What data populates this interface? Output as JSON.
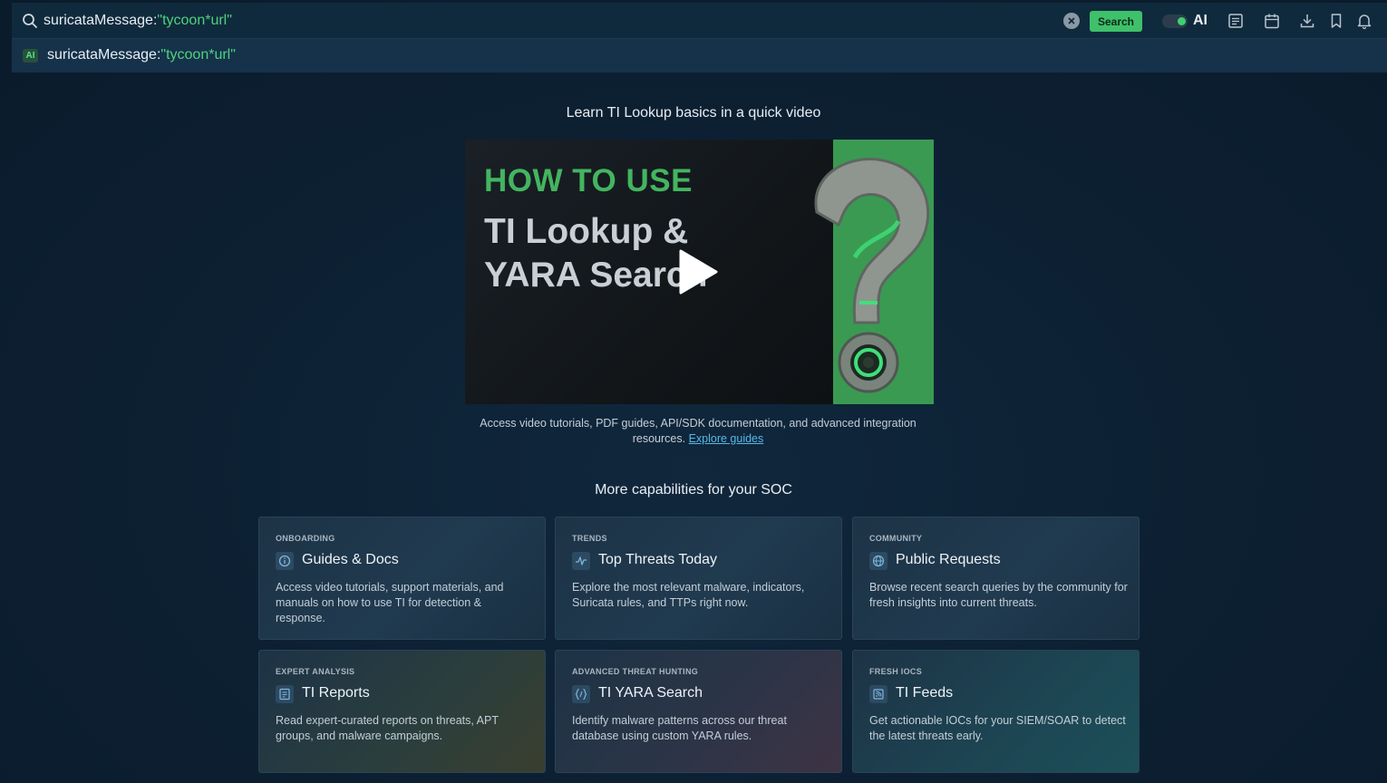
{
  "search": {
    "query_prefix": "suricataMessage:",
    "query_string": "\"tycoon*url\"",
    "button_label": "Search",
    "ai_label": "AI"
  },
  "suggestion": {
    "badge": "AI",
    "prefix": "suricataMessage:",
    "string": "\"tycoon*url\""
  },
  "video_section": {
    "heading": "Learn TI Lookup basics in a quick video",
    "thumb_line1": "HOW TO USE",
    "thumb_line2": "TI Lookup &",
    "thumb_line3": "YARA Search",
    "description": "Access video tutorials, PDF guides, API/SDK documentation, and advanced integration resources.",
    "link": "Explore guides"
  },
  "capabilities": {
    "heading": "More capabilities for your SOC",
    "cards": [
      {
        "eyebrow": "ONBOARDING",
        "title": "Guides & Docs",
        "body": "Access video tutorials, support materials, and manuals on how to use TI for detection & response.",
        "icon": "info-circle-icon"
      },
      {
        "eyebrow": "TRENDS",
        "title": "Top Threats Today",
        "body": "Explore the most relevant malware, indicators, Suricata rules, and TTPs right now.",
        "icon": "pulse-icon"
      },
      {
        "eyebrow": "COMMUNITY",
        "title": "Public Requests",
        "body": "Browse recent search queries by the community for fresh insights into current threats.",
        "icon": "globe-icon"
      },
      {
        "eyebrow": "EXPERT ANALYSIS",
        "title": "TI Reports",
        "body": "Read expert-curated reports on threats, APT groups, and malware campaigns.",
        "icon": "report-icon"
      },
      {
        "eyebrow": "ADVANCED THREAT HUNTING",
        "title": "TI YARA Search",
        "body": "Identify malware patterns across our threat database using custom YARA rules.",
        "icon": "code-braces-icon"
      },
      {
        "eyebrow": "FRESH IOCS",
        "title": "TI Feeds",
        "body": "Get actionable IOCs for your SIEM/SOAR to detect the latest threats early.",
        "icon": "feed-icon"
      }
    ]
  },
  "colors": {
    "accent_green": "#3fc06a",
    "background": "#0d2033",
    "link": "#56b9e8"
  }
}
